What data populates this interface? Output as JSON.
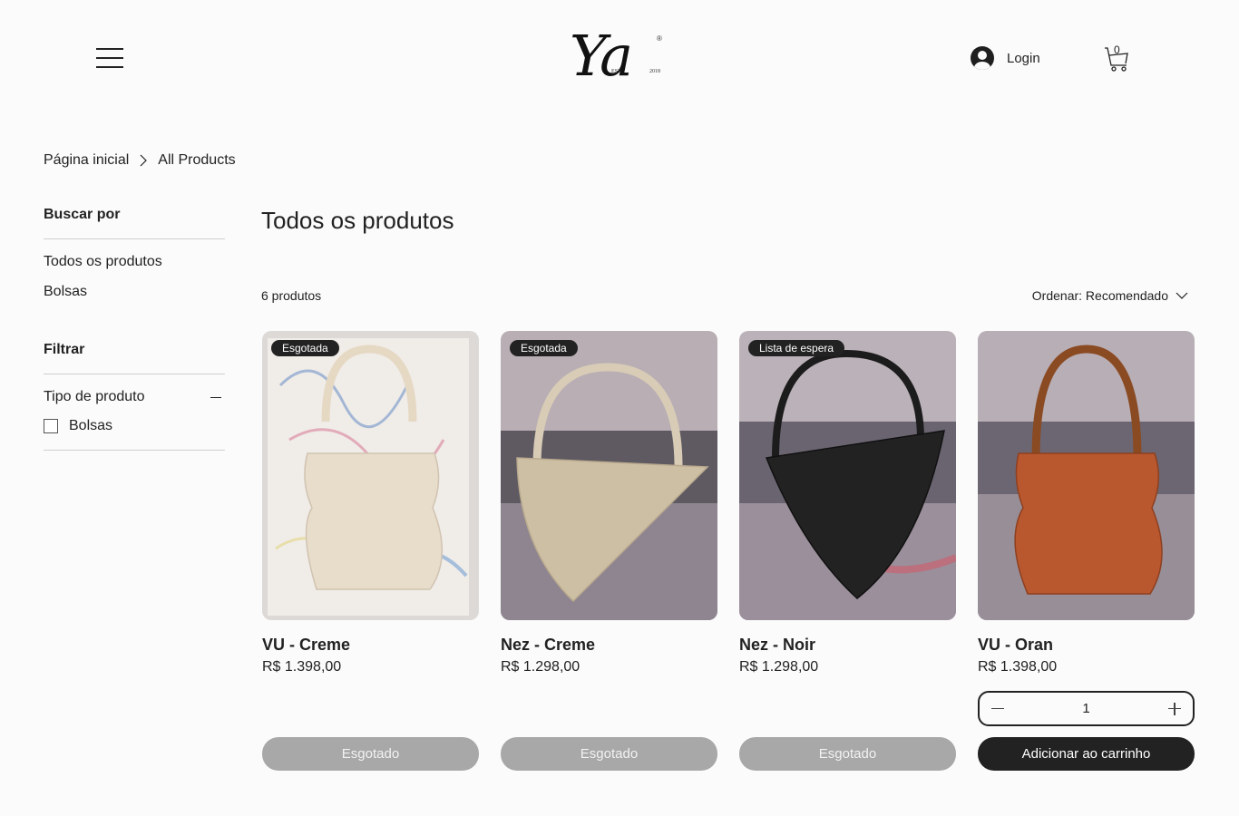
{
  "header": {
    "menu_icon": "hamburger-menu-icon",
    "logo_mark": "Ya",
    "logo_est": "EST",
    "logo_year": "2018",
    "logo_reg": "®",
    "login_label": "Login",
    "cart_count": "0"
  },
  "breadcrumb": {
    "home": "Página inicial",
    "current": "All Products"
  },
  "sidebar": {
    "browse_heading": "Buscar por",
    "links": [
      "Todos os produtos",
      "Bolsas"
    ],
    "filter_heading": "Filtrar",
    "filter_group": "Tipo de produto",
    "filter_option": "Bolsas"
  },
  "main": {
    "title": "Todos os produtos",
    "count": "6 produtos",
    "sort": "Ordenar: Recomendado"
  },
  "products": [
    {
      "badge": "Esgotada",
      "name": "VU - Creme",
      "price": "R$ 1.398,00",
      "button": "Esgotado"
    },
    {
      "badge": "Esgotada",
      "name": "Nez - Creme",
      "price": "R$ 1.298,00",
      "button": "Esgotado"
    },
    {
      "badge": "Lista de espera",
      "name": "Nez - Noir",
      "price": "R$ 1.298,00",
      "button": "Esgotado"
    },
    {
      "badge": "",
      "name": "VU - Oran",
      "price": "R$ 1.398,00",
      "quantity": "1",
      "button": "Adicionar ao carrinho"
    }
  ],
  "colors": {
    "text": "#222222",
    "disabled_button": "#a8a8a8",
    "primary_button": "#222222",
    "background": "#fbfbfb"
  }
}
